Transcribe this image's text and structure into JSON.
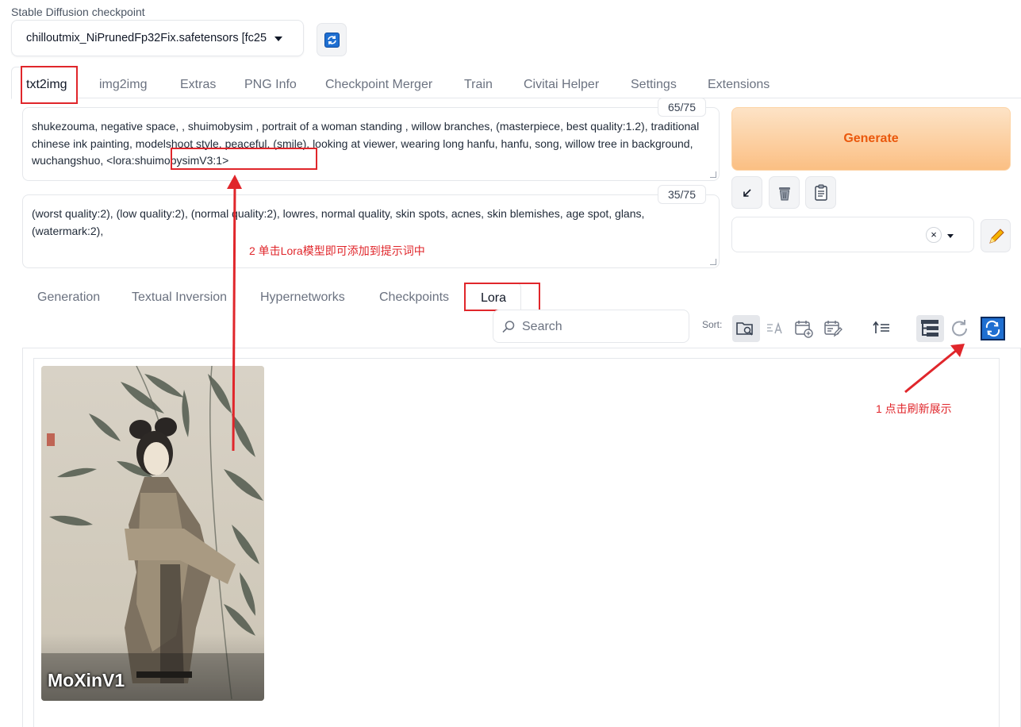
{
  "checkpoint": {
    "label": "Stable Diffusion checkpoint",
    "value": "chilloutmix_NiPrunedFp32Fix.safetensors [fc25"
  },
  "main_tabs": [
    "txt2img",
    "img2img",
    "Extras",
    "PNG Info",
    "Checkpoint Merger",
    "Train",
    "Civitai Helper",
    "Settings",
    "Extensions"
  ],
  "prompt": {
    "text": "shukezouma, negative space, , shuimobysim , portrait of a woman standing , willow branches, (masterpiece, best quality:1.2), traditional chinese ink painting, modelshoot style, peaceful, (smile), looking at viewer, wearing long hanfu, hanfu, song, willow tree in background, wuchangshuo, <lora:shuimobysimV3:1>",
    "token_count": "65/75"
  },
  "negative_prompt": {
    "text": "(worst quality:2), (low quality:2), (normal quality:2), lowres, normal quality, skin spots, acnes, skin blemishes, age spot, glans, (watermark:2),",
    "token_count": "35/75"
  },
  "generate_label": "Generate",
  "tools": {
    "read_params": "↙",
    "clear": "trash",
    "paste": "clipboard"
  },
  "styles": {
    "clear": "×"
  },
  "extra_tabs": [
    "Generation",
    "Textual Inversion",
    "Hypernetworks",
    "Checkpoints",
    "Lora"
  ],
  "search": {
    "placeholder": "Search"
  },
  "sort_label": "Sort:",
  "card": {
    "name": "MoXinV1"
  },
  "annotations": {
    "step1": "1 点击刷新展示",
    "step2": "2 单击Lora模型即可添加到提示词中"
  },
  "colors": {
    "accent_red": "#e0262b",
    "generate_text": "#ea580c",
    "refresh_blue": "#1f6fd1"
  }
}
